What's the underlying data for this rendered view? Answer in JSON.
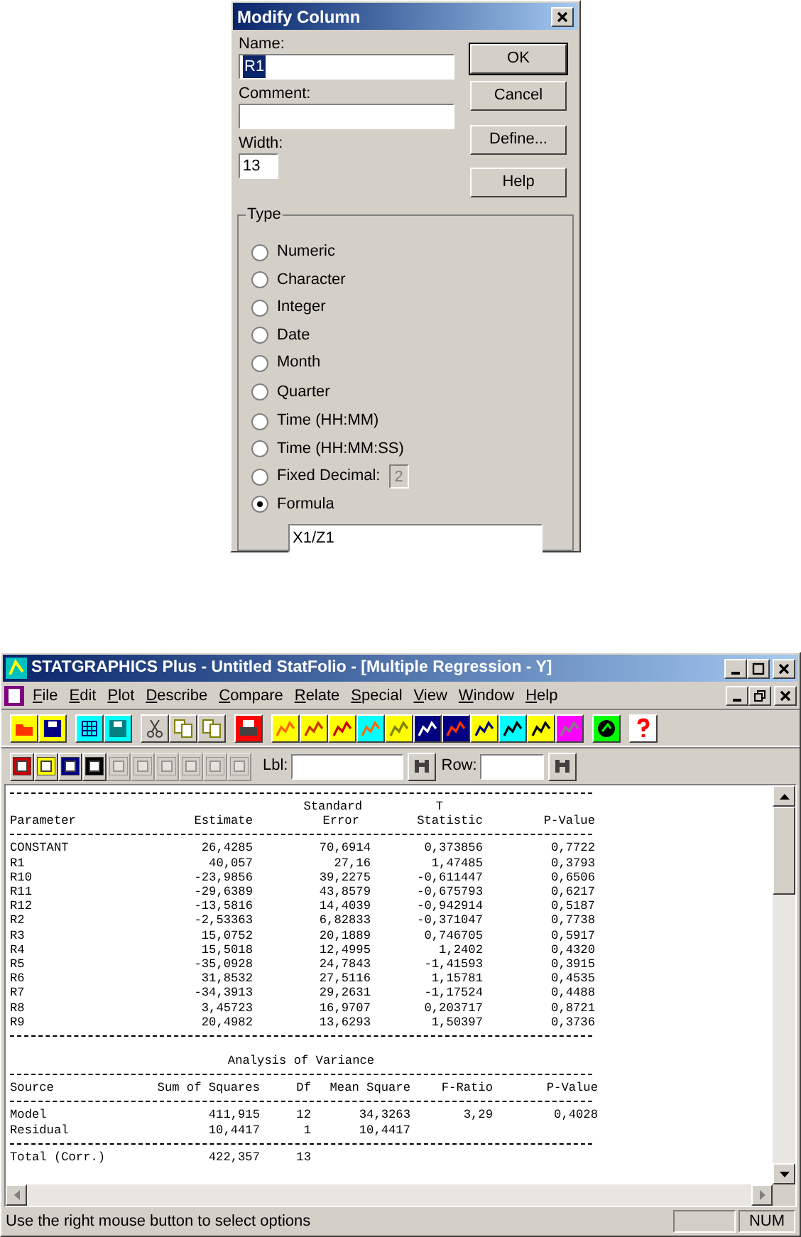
{
  "dialog": {
    "title": "Modify Column",
    "fields": [
      {
        "label": "Name:",
        "value": "R1",
        "selected": true
      },
      {
        "label": "Comment:"
      },
      {
        "label": "Width:",
        "value": "13",
        "selected": false
      }
    ],
    "buttons": [
      {
        "label": "OK",
        "default": true
      },
      {
        "label": "Cancel",
        "default": false
      },
      {
        "label": "Define...",
        "default": false
      },
      {
        "label": "Help",
        "default": false
      }
    ],
    "type_group": {
      "title": "Type",
      "options": [
        {
          "label": "Numeric",
          "selected": false
        },
        {
          "label": "Character",
          "selected": false
        },
        {
          "label": "Integer",
          "selected": false
        },
        {
          "label": "Date",
          "selected": false
        },
        {
          "label": "Month",
          "selected": false
        },
        {
          "label": "Quarter",
          "selected": false
        },
        {
          "label": "Time (HH:MM)",
          "selected": false
        },
        {
          "label": "Time (HH:MM:SS)",
          "selected": false
        },
        {
          "label": "Fixed Decimal:",
          "selected": false,
          "field": {
            "value": "2",
            "disabled": true
          }
        },
        {
          "label": "Formula",
          "selected": true
        }
      ],
      "formula": {
        "value": "X1/Z1"
      }
    }
  },
  "app": {
    "title": "STATGRAPHICS Plus - Untitled StatFolio - [Multiple Regression - Y]",
    "menu": [
      "File",
      "Edit",
      "Plot",
      "Describe",
      "Compare",
      "Relate",
      "Special",
      "View",
      "Window",
      "Help"
    ],
    "toolbar2": [
      {
        "disabled": false
      },
      {
        "disabled": false
      },
      {
        "disabled": false
      },
      {
        "disabled": false
      },
      {
        "disabled": true
      },
      {
        "disabled": true
      },
      {
        "disabled": true
      },
      {
        "disabled": true
      },
      {
        "disabled": true
      },
      {
        "disabled": true
      }
    ],
    "lbl_field": {
      "label": "Lbl:"
    },
    "row_field": {
      "label": "Row:"
    },
    "regression": {
      "columns": [
        {
          "label": "Parameter"
        },
        {
          "label": "Estimate"
        },
        {
          "top": "Standard",
          "label": "Error"
        },
        {
          "top": "T",
          "label": "Statistic"
        },
        {
          "label": "P-Value"
        }
      ],
      "rows": [
        [
          "CONSTANT",
          "26,4285",
          "70,6914",
          "0,373856",
          "0,7722"
        ],
        [
          "R1",
          "40,057",
          "27,16",
          "1,47485",
          "0,3793"
        ],
        [
          "R10",
          "-23,9856",
          "39,2275",
          "-0,611447",
          "0,6506"
        ],
        [
          "R11",
          "-29,6389",
          "43,8579",
          "-0,675793",
          "0,6217"
        ],
        [
          "R12",
          "-13,5816",
          "14,4039",
          "-0,942914",
          "0,5187"
        ],
        [
          "R2",
          "-2,53363",
          "6,82833",
          "-0,371047",
          "0,7738"
        ],
        [
          "R3",
          "15,0752",
          "20,1889",
          "0,746705",
          "0,5917"
        ],
        [
          "R4",
          "15,5018",
          "12,4995",
          "1,2402",
          "0,4320"
        ],
        [
          "R5",
          "-35,0928",
          "24,7843",
          "-1,41593",
          "0,3915"
        ],
        [
          "R6",
          "31,8532",
          "27,5116",
          "1,15781",
          "0,4535"
        ],
        [
          "R7",
          "-34,3913",
          "29,2631",
          "-1,17524",
          "0,4488"
        ],
        [
          "R8",
          "3,45723",
          "16,9707",
          "0,203717",
          "0,8721"
        ],
        [
          "R9",
          "20,4982",
          "13,6293",
          "1,50397",
          "0,3736"
        ]
      ]
    },
    "anova": {
      "title": "Analysis of Variance",
      "columns": [
        "Source",
        "Sum of Squares",
        "Df",
        "Mean Square",
        "F-Ratio",
        "P-Value"
      ],
      "rows": [
        [
          "Model",
          "411,915",
          "12",
          "34,3263",
          "3,29",
          "0,4028"
        ],
        [
          "Residual",
          "10,4417",
          "1",
          "10,4417"
        ]
      ],
      "total": [
        "Total (Corr.)",
        "422,357",
        "13"
      ]
    },
    "status_bar": {
      "text": "Use the right mouse button to select options",
      "indicators": [
        "NUM"
      ]
    }
  }
}
